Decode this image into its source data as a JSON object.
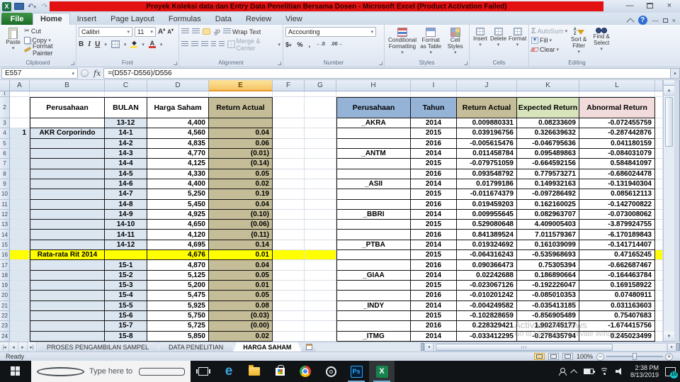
{
  "window": {
    "title": "Proyek Koleksi data dan Entry Data Penelitian Bersama Dosen  -  Microsoft Excel (Product Activation Failed)"
  },
  "ribbon": {
    "tabs": [
      "File",
      "Home",
      "Insert",
      "Page Layout",
      "Formulas",
      "Data",
      "Review",
      "View"
    ],
    "active_tab": "Home",
    "clipboard": {
      "label": "Clipboard",
      "paste": "Paste",
      "cut": "Cut",
      "copy": "Copy",
      "format_painter": "Format Painter"
    },
    "font": {
      "label": "Font",
      "family": "Calibri",
      "size": "11",
      "bold": "B",
      "italic": "I",
      "underline": "U",
      "grow": "A",
      "shrink": "A",
      "color": "A"
    },
    "alignment": {
      "label": "Alignment",
      "wrap_text": "Wrap Text",
      "merge_center": "Merge & Center"
    },
    "number": {
      "label": "Number",
      "format": "Accounting",
      "dollar": "$",
      "percent": "%",
      "comma": ","
    },
    "styles": {
      "label": "Styles",
      "conditional": "Conditional Formatting",
      "format_table": "Format as Table",
      "cell_styles": "Cell Styles"
    },
    "cells": {
      "label": "Cells",
      "insert": "Insert",
      "delete": "Delete",
      "format": "Format"
    },
    "editing": {
      "label": "Editing",
      "sigma": "Σ",
      "autosum": "AutoSum",
      "fill": "Fill",
      "clear": "Clear",
      "sort_filter": "Sort & Filter",
      "find_select": "Find & Select"
    }
  },
  "formula_bar": {
    "name_box": "E557",
    "fx": "fx",
    "formula": "=(D557-D556)/D556"
  },
  "grid": {
    "columns": [
      "A",
      "B",
      "C",
      "D",
      "E",
      "F",
      "G",
      "H",
      "I",
      "J",
      "K",
      "L"
    ],
    "selected_column": "E",
    "first_row": 1,
    "last_row": 24,
    "left_table": {
      "headers": {
        "perusahaan": "Perusahaan",
        "bulan": "BULAN",
        "harga": "Harga Saham",
        "ret": "Return Actual"
      },
      "rows": [
        {
          "row": 3,
          "a": "",
          "perusahaan": "",
          "bulan": "13-12",
          "harga": "4,400",
          "ret": ""
        },
        {
          "row": 4,
          "a": "1",
          "perusahaan": "AKR Corporindo",
          "bulan": "14-1",
          "harga": "4,560",
          "ret": "0.04"
        },
        {
          "row": 5,
          "a": "",
          "perusahaan": "",
          "bulan": "14-2",
          "harga": "4,835",
          "ret": "0.06"
        },
        {
          "row": 6,
          "a": "",
          "perusahaan": "",
          "bulan": "14-3",
          "harga": "4,770",
          "ret": "(0.01)"
        },
        {
          "row": 7,
          "a": "",
          "perusahaan": "",
          "bulan": "14-4",
          "harga": "4,125",
          "ret": "(0.14)"
        },
        {
          "row": 8,
          "a": "",
          "perusahaan": "",
          "bulan": "14-5",
          "harga": "4,330",
          "ret": "0.05"
        },
        {
          "row": 9,
          "a": "",
          "perusahaan": "",
          "bulan": "14-6",
          "harga": "4,400",
          "ret": "0.02"
        },
        {
          "row": 10,
          "a": "",
          "perusahaan": "",
          "bulan": "14-7",
          "harga": "5,250",
          "ret": "0.19"
        },
        {
          "row": 11,
          "a": "",
          "perusahaan": "",
          "bulan": "14-8",
          "harga": "5,450",
          "ret": "0.04"
        },
        {
          "row": 12,
          "a": "",
          "perusahaan": "",
          "bulan": "14-9",
          "harga": "4,925",
          "ret": "(0.10)"
        },
        {
          "row": 13,
          "a": "",
          "perusahaan": "",
          "bulan": "14-10",
          "harga": "4,650",
          "ret": "(0.06)"
        },
        {
          "row": 14,
          "a": "",
          "perusahaan": "",
          "bulan": "14-11",
          "harga": "4,120",
          "ret": "(0.11)"
        },
        {
          "row": 15,
          "a": "",
          "perusahaan": "",
          "bulan": "14-12",
          "harga": "4,695",
          "ret": "0.14"
        },
        {
          "row": 16,
          "a": "",
          "perusahaan": "Rata-rata Rit 2014",
          "bulan": "",
          "harga": "4,676",
          "ret": "0.01",
          "highlight": true
        },
        {
          "row": 17,
          "a": "",
          "perusahaan": "",
          "bulan": "15-1",
          "harga": "4,870",
          "ret": "0.04"
        },
        {
          "row": 18,
          "a": "",
          "perusahaan": "",
          "bulan": "15-2",
          "harga": "5,125",
          "ret": "0.05"
        },
        {
          "row": 19,
          "a": "",
          "perusahaan": "",
          "bulan": "15-3",
          "harga": "5,200",
          "ret": "0.01"
        },
        {
          "row": 20,
          "a": "",
          "perusahaan": "",
          "bulan": "15-4",
          "harga": "5,475",
          "ret": "0.05"
        },
        {
          "row": 21,
          "a": "",
          "perusahaan": "",
          "bulan": "15-5",
          "harga": "5,925",
          "ret": "0.08"
        },
        {
          "row": 22,
          "a": "",
          "perusahaan": "",
          "bulan": "15-6",
          "harga": "5,750",
          "ret": "(0.03)"
        },
        {
          "row": 23,
          "a": "",
          "perusahaan": "",
          "bulan": "15-7",
          "harga": "5,725",
          "ret": "(0.00)"
        },
        {
          "row": 24,
          "a": "",
          "perusahaan": "",
          "bulan": "15-8",
          "harga": "5,850",
          "ret": "0.02"
        }
      ]
    },
    "right_table": {
      "headers": [
        "Perusahaan",
        "Tahun",
        "Return Actual",
        "Expected Return",
        "Abnormal Return"
      ],
      "rows": [
        {
          "row": 3,
          "perusahaan": "_AKRA",
          "tahun": "2014",
          "return_actual": "0.009880331",
          "expected_return": "0.08233609",
          "abnormal_return": "-0.072455759"
        },
        {
          "row": 4,
          "perusahaan": "",
          "tahun": "2015",
          "return_actual": "0.039196756",
          "expected_return": "0.326639632",
          "abnormal_return": "-0.287442876"
        },
        {
          "row": 5,
          "perusahaan": "",
          "tahun": "2016",
          "return_actual": "-0.005615476",
          "expected_return": "-0.046795636",
          "abnormal_return": "0.041180159"
        },
        {
          "row": 6,
          "perusahaan": "_ANTM",
          "tahun": "2014",
          "return_actual": "0.011458784",
          "expected_return": "0.095489863",
          "abnormal_return": "-0.084031079"
        },
        {
          "row": 7,
          "perusahaan": "",
          "tahun": "2015",
          "return_actual": "-0.079751059",
          "expected_return": "-0.664592156",
          "abnormal_return": "0.584841097"
        },
        {
          "row": 8,
          "perusahaan": "",
          "tahun": "2016",
          "return_actual": "0.093548792",
          "expected_return": "0.779573271",
          "abnormal_return": "-0.686024478"
        },
        {
          "row": 9,
          "perusahaan": "_ASII",
          "tahun": "2014",
          "return_actual": "0.01799186",
          "expected_return": "0.149932163",
          "abnormal_return": "-0.131940304"
        },
        {
          "row": 10,
          "perusahaan": "",
          "tahun": "2015",
          "return_actual": "-0.011674379",
          "expected_return": "-0.097286492",
          "abnormal_return": "0.085612113"
        },
        {
          "row": 11,
          "perusahaan": "",
          "tahun": "2016",
          "return_actual": "0.019459203",
          "expected_return": "0.162160025",
          "abnormal_return": "-0.142700822"
        },
        {
          "row": 12,
          "perusahaan": "_BBRI",
          "tahun": "2014",
          "return_actual": "0.009955645",
          "expected_return": "0.082963707",
          "abnormal_return": "-0.073008062"
        },
        {
          "row": 13,
          "perusahaan": "",
          "tahun": "2015",
          "return_actual": "0.529080648",
          "expected_return": "4.409005403",
          "abnormal_return": "-3.879924755"
        },
        {
          "row": 14,
          "perusahaan": "",
          "tahun": "2016",
          "return_actual": "0.841389524",
          "expected_return": "7.011579367",
          "abnormal_return": "-6.170189843"
        },
        {
          "row": 15,
          "perusahaan": "_PTBA",
          "tahun": "2014",
          "return_actual": "0.019324692",
          "expected_return": "0.161039099",
          "abnormal_return": "-0.141714407"
        },
        {
          "row": 16,
          "perusahaan": "",
          "tahun": "2015",
          "return_actual": "-0.064316243",
          "expected_return": "-0.535968693",
          "abnormal_return": "0.47165245"
        },
        {
          "row": 17,
          "perusahaan": "",
          "tahun": "2016",
          "return_actual": "0.090366473",
          "expected_return": "0.75305394",
          "abnormal_return": "-0.662687467"
        },
        {
          "row": 18,
          "perusahaan": "_GIAA",
          "tahun": "2014",
          "return_actual": "0.02242688",
          "expected_return": "0.186890664",
          "abnormal_return": "-0.164463784"
        },
        {
          "row": 19,
          "perusahaan": "",
          "tahun": "2015",
          "return_actual": "-0.023067126",
          "expected_return": "-0.192226047",
          "abnormal_return": "0.169158922"
        },
        {
          "row": 20,
          "perusahaan": "",
          "tahun": "2016",
          "return_actual": "-0.010201242",
          "expected_return": "-0.085010353",
          "abnormal_return": "0.07480911"
        },
        {
          "row": 21,
          "perusahaan": "_INDY",
          "tahun": "2014",
          "return_actual": "-0.004249582",
          "expected_return": "-0.035413185",
          "abnormal_return": "0.031163603"
        },
        {
          "row": 22,
          "perusahaan": "",
          "tahun": "2015",
          "return_actual": "-0.102828659",
          "expected_return": "-0.856905489",
          "abnormal_return": "0.75407683"
        },
        {
          "row": 23,
          "perusahaan": "",
          "tahun": "2016",
          "return_actual": "0.228329421",
          "expected_return": "1.902745177",
          "abnormal_return": "-1.674415756"
        },
        {
          "row": 24,
          "perusahaan": "_ITMG",
          "tahun": "2014",
          "return_actual": "-0.033412295",
          "expected_return": "-0.278435794",
          "abnormal_return": "0.245023499"
        }
      ]
    },
    "watermark": {
      "line1": "Activate Windows",
      "line2": "Go to Settings to activate Windows."
    }
  },
  "sheet_tabs": {
    "tabs": [
      "PROSES PENGAMBILAN SAMPEL",
      "DATA PENELITIAN",
      "HARGA SAHAM"
    ],
    "active": "HARGA SAHAM"
  },
  "status_bar": {
    "mode": "Ready",
    "zoom": "100%"
  },
  "taskbar": {
    "search_placeholder": "Type here to search",
    "edge_glyph": "e",
    "photoshop_glyph": "Ps",
    "excel_glyph": "X",
    "clock": {
      "time": "2:38 PM",
      "date": "8/13/2019"
    },
    "notification_count": "10"
  },
  "colors": {
    "selection_yellow": "#ffff00",
    "left_blue": "#dce6f1",
    "return_tan": "#c5bd97",
    "hdr_blue": "#95b3d7",
    "hdr_green": "#d7e4bc",
    "hdr_pink": "#f2dcdb",
    "title_red": "#e31212",
    "excel_green": "#1e7145"
  }
}
